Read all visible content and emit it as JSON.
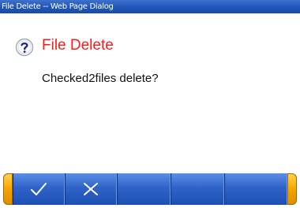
{
  "window": {
    "title": "File Delete -- Web Page Dialog"
  },
  "dialog": {
    "heading": "File Delete",
    "message": "Checked2files delete?",
    "icon": "help-icon",
    "heading_color": "#ff1a1a"
  },
  "toolbar": {
    "buttons": [
      {
        "name": "confirm",
        "icon": "checkmark-icon"
      },
      {
        "name": "cancel",
        "icon": "close-icon"
      },
      {
        "name": "empty",
        "icon": ""
      },
      {
        "name": "empty",
        "icon": ""
      },
      {
        "name": "empty",
        "icon": ""
      }
    ],
    "colors": {
      "button_blue": "#2f63c8",
      "cap_orange": "#f5a400"
    }
  }
}
